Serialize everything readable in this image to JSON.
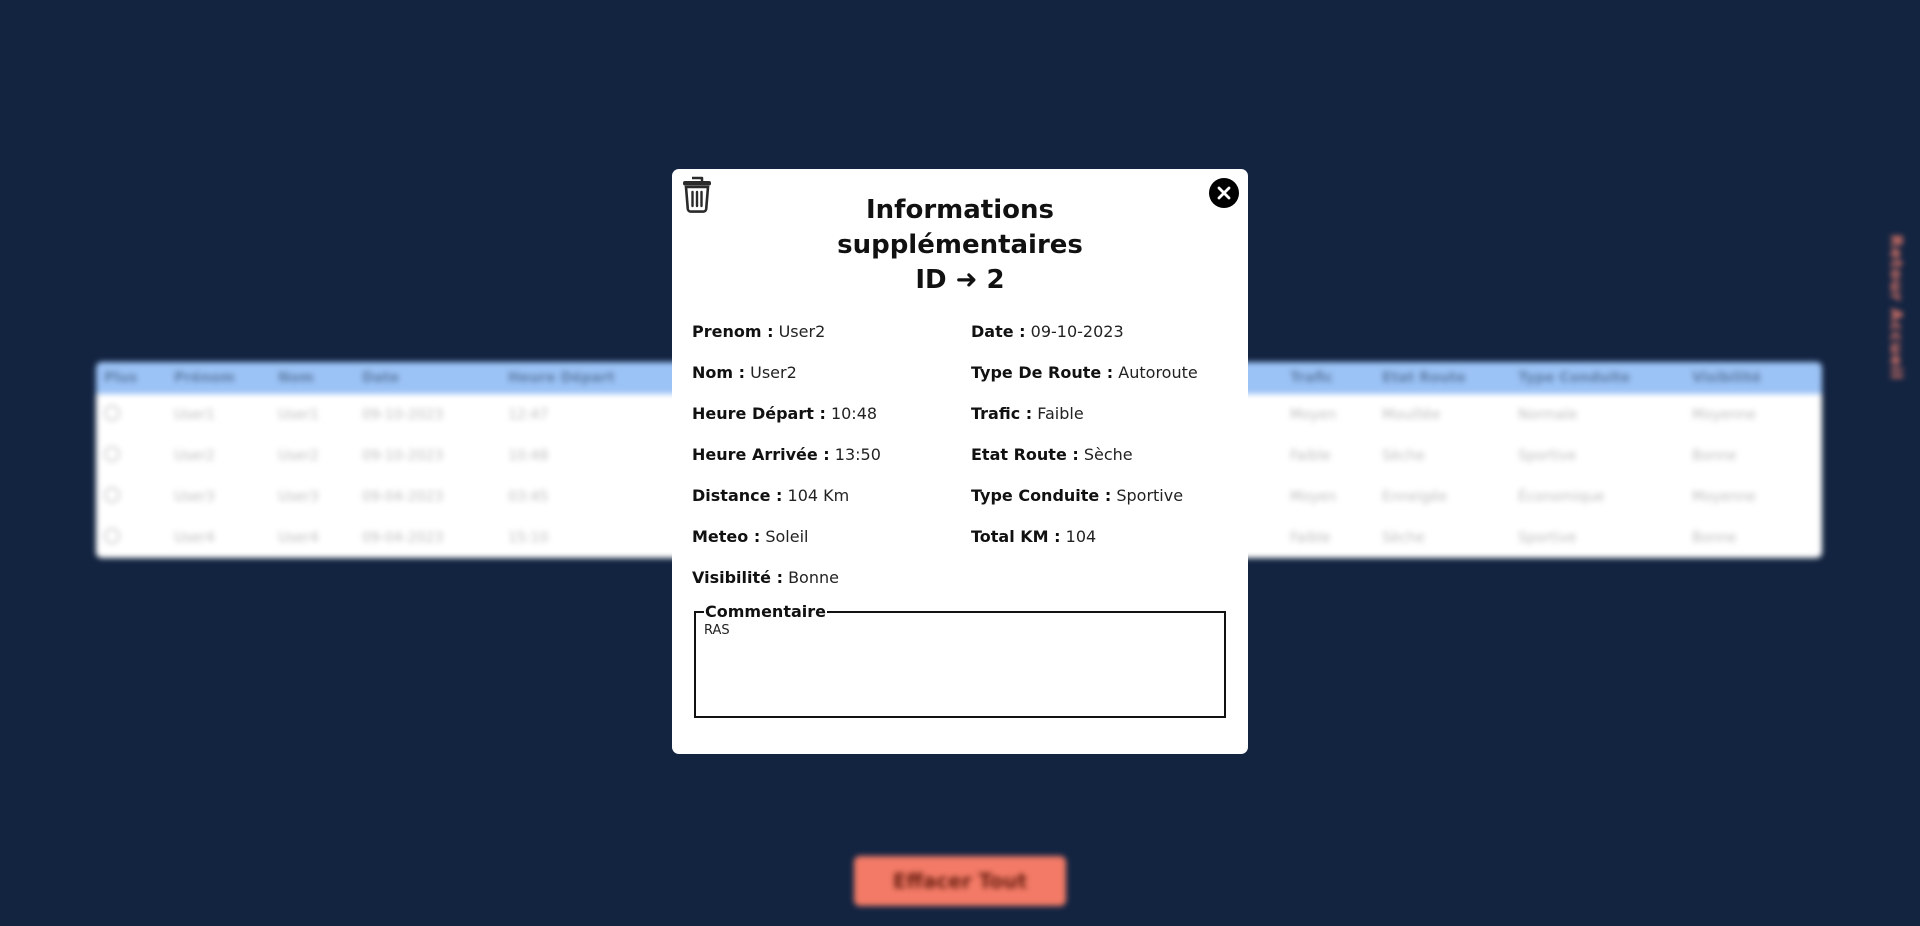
{
  "background": {
    "table": {
      "headers": [
        "Plus",
        "Prénom",
        "Nom",
        "Date",
        "Heure Départ",
        "",
        "Trafic",
        "Etat Route",
        "Type Conduite",
        "Visibilité"
      ],
      "rows": [
        [
          "User1",
          "User1",
          "09-10-2023",
          "12:47",
          "Moyen",
          "Mouillée",
          "Normale",
          "Moyenne"
        ],
        [
          "User2",
          "User2",
          "09-10-2023",
          "10:48",
          "Faible",
          "Sèche",
          "Sportive",
          "Bonne"
        ],
        [
          "User3",
          "User3",
          "09-04-2023",
          "03:45",
          "Moyen",
          "Enneigée",
          "Économique",
          "Moyenne"
        ],
        [
          "User4",
          "User4",
          "09-04-2023",
          "15:10",
          "Faible",
          "Sèche",
          "Sportive",
          "Bonne"
        ]
      ]
    },
    "side_link": "Retour Accueil",
    "delete_all_label": "Effacer Tout"
  },
  "modal": {
    "title_line1": "Informations",
    "title_line2": "supplémentaires",
    "title_line3": "ID ➜ 2",
    "icons": {
      "delete": "trash-icon",
      "close": "close-icon"
    },
    "fields": {
      "prenom": {
        "label": "Prenom :",
        "value": "User2"
      },
      "date": {
        "label": "Date :",
        "value": "09-10-2023"
      },
      "nom": {
        "label": "Nom :",
        "value": "User2"
      },
      "type_route": {
        "label": "Type De Route :",
        "value": "Autoroute"
      },
      "heure_depart": {
        "label": "Heure Départ :",
        "value": "10:48"
      },
      "trafic": {
        "label": "Trafic :",
        "value": "Faible"
      },
      "heure_arrivee": {
        "label": "Heure Arrivée :",
        "value": "13:50"
      },
      "etat_route": {
        "label": "Etat Route :",
        "value": "Sèche"
      },
      "distance": {
        "label": "Distance :",
        "value": "104 Km"
      },
      "type_conduite": {
        "label": "Type Conduite :",
        "value": "Sportive"
      },
      "meteo": {
        "label": "Meteo :",
        "value": "Soleil"
      },
      "total_km": {
        "label": "Total KM :",
        "value": "104"
      },
      "visibilite": {
        "label": "Visibilité :",
        "value": "Bonne"
      }
    },
    "comment": {
      "legend": "Commentaire",
      "text": "RAS"
    }
  },
  "colors": {
    "page_bg": "#132441",
    "accent_coral": "#f27a66",
    "table_header": "#9cc3f6"
  }
}
